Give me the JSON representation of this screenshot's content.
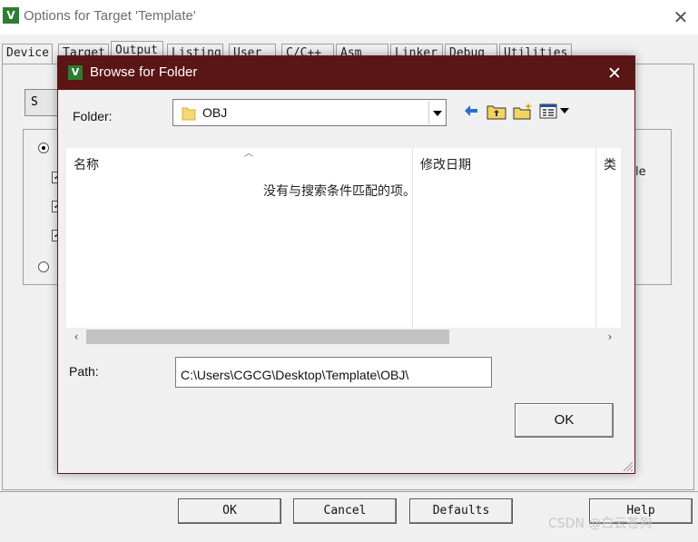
{
  "background_window": {
    "title": "Options for Target 'Template'",
    "tabs": [
      {
        "label": "Device"
      },
      {
        "label": "Target"
      },
      {
        "label": "Output"
      },
      {
        "label": "Listing"
      },
      {
        "label": "User"
      },
      {
        "label": "C/C++"
      },
      {
        "label": "Asm"
      },
      {
        "label": "Linker"
      },
      {
        "label": "Debug"
      },
      {
        "label": "Utilities"
      }
    ],
    "active_tab": "Output",
    "partial_button_label": "S",
    "partial_right_text": "le",
    "buttons": {
      "ok": "OK",
      "cancel": "Cancel",
      "defaults": "Defaults",
      "help": "Help"
    }
  },
  "dialog": {
    "title": "Browse for Folder",
    "folder_label": "Folder:",
    "folder_value": "OBJ",
    "columns": [
      {
        "label": "名称"
      },
      {
        "label": "修改日期"
      },
      {
        "label": "类"
      }
    ],
    "empty_message": "没有与搜索条件匹配的项。",
    "path_label": "Path:",
    "path_value": "C:\\Users\\CGCG\\Desktop\\Template\\OBJ\\",
    "ok_label": "OK",
    "colors": {
      "titlebar": "#5a1515",
      "app_icon": "#2e7d32"
    }
  },
  "watermark": "CSDN @白云苍狗"
}
